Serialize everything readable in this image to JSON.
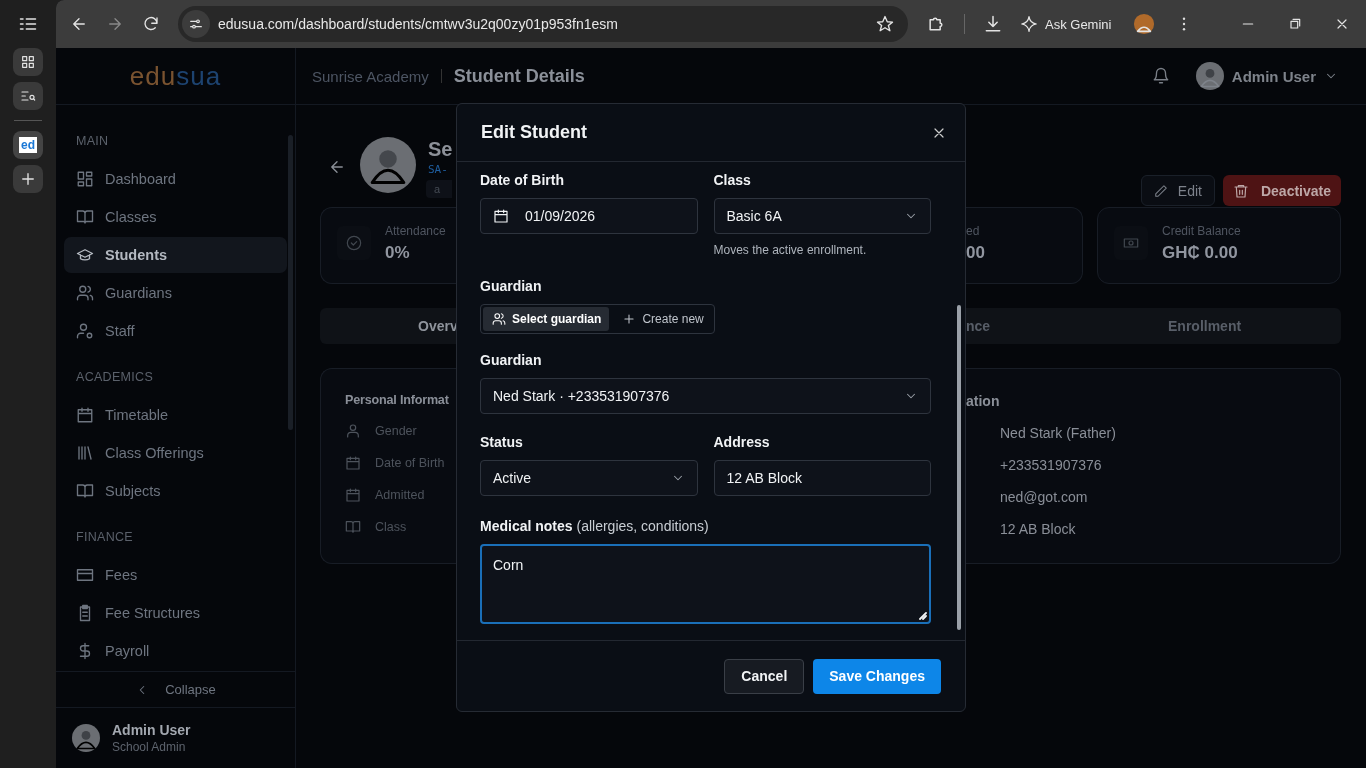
{
  "browser": {
    "tab_favicon": "ed",
    "url": "edusua.com/dashboard/students/cmtwv3u2q00zy01p953fn1esm",
    "gemini_label": "Ask Gemini"
  },
  "app_header": {
    "logo_parts": [
      "edu",
      "sua"
    ],
    "school": "Sunrise Academy",
    "page_title": "Student Details",
    "user": "Admin User"
  },
  "sidebar": {
    "sections": [
      {
        "heading": "MAIN",
        "items": [
          {
            "label": "Dashboard",
            "selected": false
          },
          {
            "label": "Classes",
            "selected": false
          },
          {
            "label": "Students",
            "selected": true
          },
          {
            "label": "Guardians",
            "selected": false
          },
          {
            "label": "Staff",
            "selected": false
          }
        ]
      },
      {
        "heading": "ACADEMICS",
        "items": [
          {
            "label": "Timetable",
            "selected": false
          },
          {
            "label": "Class Offerings",
            "selected": false
          },
          {
            "label": "Subjects",
            "selected": false
          }
        ]
      },
      {
        "heading": "FINANCE",
        "items": [
          {
            "label": "Fees",
            "selected": false
          },
          {
            "label": "Fee Structures",
            "selected": false
          },
          {
            "label": "Payroll",
            "selected": false
          }
        ]
      }
    ],
    "collapse": "Collapse",
    "user": {
      "name": "Admin User",
      "role": "School Admin"
    }
  },
  "student": {
    "name": "Se",
    "id": "SA-",
    "chip": "a",
    "buttons": {
      "edit": "Edit",
      "deactivate": "Deactivate"
    }
  },
  "stats": [
    {
      "label": "Attendance",
      "value": "0%"
    },
    {
      "label": "ed",
      "value": "00"
    },
    {
      "label": "Credit Balance",
      "value": "GH₵ 0.00"
    }
  ],
  "tabs": [
    {
      "label": "Overv",
      "selected": true
    },
    {
      "label": "nce",
      "selected": false
    },
    {
      "label": "Enrollment",
      "selected": false
    }
  ],
  "info": {
    "left_title": "Personal Informat",
    "fields": [
      "Gender",
      "Date of Birth",
      "Admitted",
      "Class"
    ],
    "right_title": "ation",
    "values": [
      "Ned Stark (Father)",
      "+233531907376",
      "ned@got.com",
      "12 AB Block"
    ]
  },
  "modal": {
    "title": "Edit Student",
    "dob": {
      "label": "Date of Birth",
      "value": "01/09/2026"
    },
    "class": {
      "label": "Class",
      "value": "Basic 6A",
      "hint": "Moves the active enrollment."
    },
    "guardian_mode": {
      "label": "Guardian",
      "options": [
        {
          "label": "Select guardian",
          "selected": true
        },
        {
          "label": "Create new",
          "selected": false
        }
      ]
    },
    "guardian": {
      "label": "Guardian",
      "value": "Ned Stark · +233531907376"
    },
    "status": {
      "label": "Status",
      "value": "Active"
    },
    "address": {
      "label": "Address",
      "value": "12 AB Block"
    },
    "medical": {
      "label": "**Medical notes** (allergies, conditions)",
      "value": "Corn",
      "focused": true
    },
    "buttons": {
      "cancel": "Cancel",
      "save": "Save Changes"
    }
  }
}
